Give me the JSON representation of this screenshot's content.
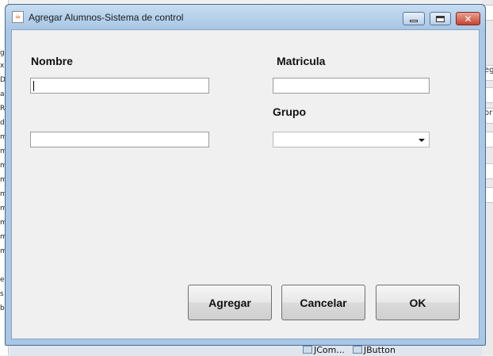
{
  "window": {
    "title": "Agregar Alumnos-Sistema de control",
    "close_symbol": "✕"
  },
  "form": {
    "nombre_label": "Nombre",
    "nombre_value": "",
    "second_value": "",
    "matricula_label": "Matricula",
    "matricula_value": "",
    "grupo_label": "Grupo",
    "grupo_selected": ""
  },
  "buttons": {
    "agregar": "Agregar",
    "cancelar": "Cancelar",
    "ok": "OK"
  },
  "background": {
    "left_fragments": [
      "gu",
      "xi",
      "D",
      "a",
      "R",
      "d",
      "m",
      "m",
      "m",
      "m",
      "m",
      "m",
      "m",
      "m",
      "m",
      "er",
      "s",
      "b"
    ],
    "right_fragments": [
      "",
      "eg",
      "",
      "or",
      "",
      "",
      ""
    ],
    "tree_items": [
      "JCom...",
      "JButton"
    ]
  }
}
